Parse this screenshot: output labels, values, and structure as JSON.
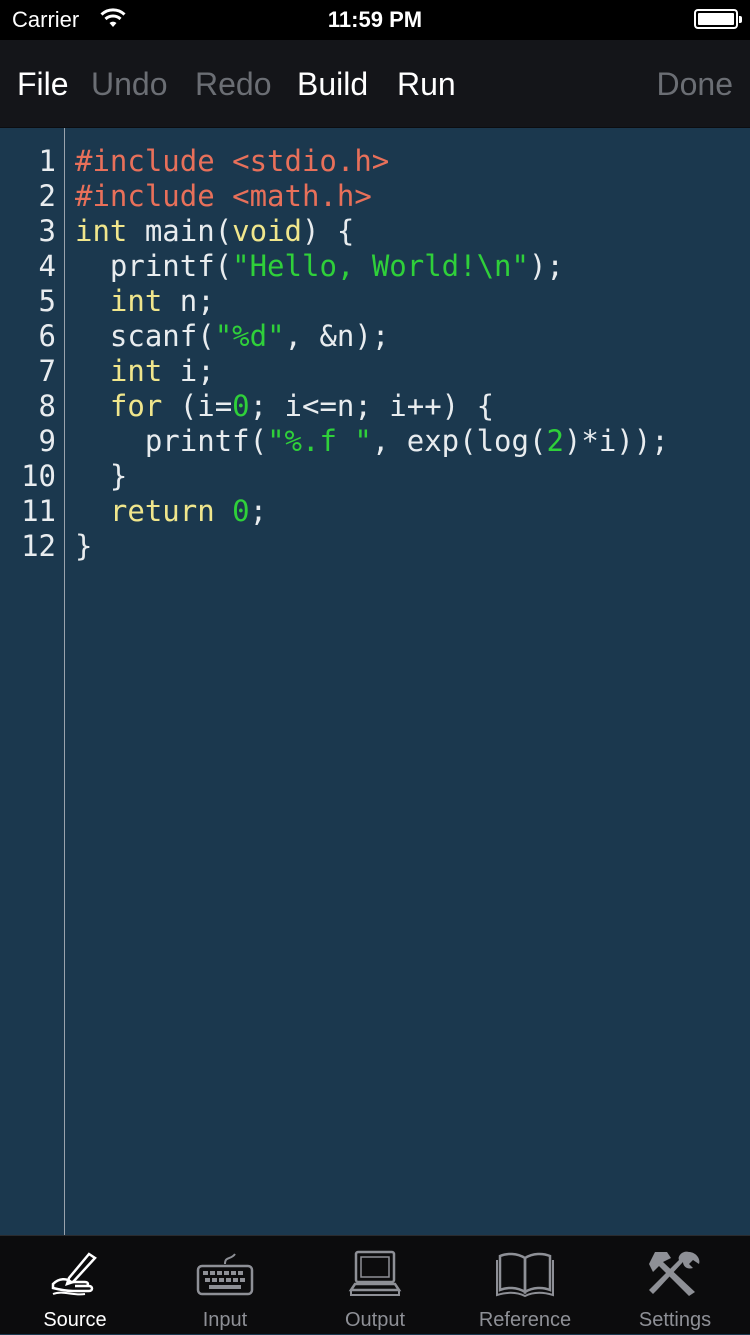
{
  "status_bar": {
    "carrier": "Carrier",
    "time": "11:59 PM",
    "battery_level": 1.0
  },
  "toolbar": {
    "file": "File",
    "undo": "Undo",
    "redo": "Redo",
    "build": "Build",
    "run": "Run",
    "done": "Done"
  },
  "colors": {
    "editor_background": "#1b384e",
    "directive": "#e8705a",
    "keyword": "#f0e68c",
    "string": "#2fd03a",
    "number": "#2fd03a",
    "plain": "#e8ecef"
  },
  "code": {
    "lines": [
      {
        "number": "1",
        "tokens": [
          {
            "t": "directive",
            "v": "#include <stdio.h>"
          }
        ]
      },
      {
        "number": "2",
        "tokens": [
          {
            "t": "directive",
            "v": "#include <math.h>"
          }
        ]
      },
      {
        "number": "3",
        "tokens": [
          {
            "t": "keyword",
            "v": "int"
          },
          {
            "t": "plain",
            "v": " main("
          },
          {
            "t": "keyword",
            "v": "void"
          },
          {
            "t": "plain",
            "v": ") {"
          }
        ]
      },
      {
        "number": "4",
        "tokens": [
          {
            "t": "plain",
            "v": "  printf("
          },
          {
            "t": "string",
            "v": "\"Hello, World!\\n\""
          },
          {
            "t": "plain",
            "v": ");"
          }
        ]
      },
      {
        "number": "5",
        "tokens": [
          {
            "t": "plain",
            "v": "  "
          },
          {
            "t": "keyword",
            "v": "int"
          },
          {
            "t": "plain",
            "v": " n;"
          }
        ]
      },
      {
        "number": "6",
        "tokens": [
          {
            "t": "plain",
            "v": "  scanf("
          },
          {
            "t": "string",
            "v": "\"%d\""
          },
          {
            "t": "plain",
            "v": ", &n);"
          }
        ]
      },
      {
        "number": "7",
        "tokens": [
          {
            "t": "plain",
            "v": "  "
          },
          {
            "t": "keyword",
            "v": "int"
          },
          {
            "t": "plain",
            "v": " i;"
          }
        ]
      },
      {
        "number": "8",
        "tokens": [
          {
            "t": "plain",
            "v": "  "
          },
          {
            "t": "keyword",
            "v": "for"
          },
          {
            "t": "plain",
            "v": " (i="
          },
          {
            "t": "number",
            "v": "0"
          },
          {
            "t": "plain",
            "v": "; i<=n; i++) {"
          }
        ]
      },
      {
        "number": "9",
        "tokens": [
          {
            "t": "plain",
            "v": "    printf("
          },
          {
            "t": "string",
            "v": "\"%.f \""
          },
          {
            "t": "plain",
            "v": ", exp(log("
          },
          {
            "t": "number",
            "v": "2"
          },
          {
            "t": "plain",
            "v": ")*i));"
          }
        ]
      },
      {
        "number": "10",
        "tokens": [
          {
            "t": "plain",
            "v": "  }"
          }
        ]
      },
      {
        "number": "11",
        "tokens": [
          {
            "t": "plain",
            "v": "  "
          },
          {
            "t": "keyword",
            "v": "return"
          },
          {
            "t": "plain",
            "v": " "
          },
          {
            "t": "number",
            "v": "0"
          },
          {
            "t": "plain",
            "v": ";"
          }
        ]
      },
      {
        "number": "12",
        "tokens": [
          {
            "t": "plain",
            "v": "}"
          }
        ]
      }
    ]
  },
  "tab_bar": {
    "tabs": [
      {
        "label": "Source",
        "icon": "pen-hand-icon",
        "active": true
      },
      {
        "label": "Input",
        "icon": "keyboard-icon",
        "active": false
      },
      {
        "label": "Output",
        "icon": "computer-icon",
        "active": false
      },
      {
        "label": "Reference",
        "icon": "book-icon",
        "active": false
      },
      {
        "label": "Settings",
        "icon": "tools-icon",
        "active": false
      }
    ]
  }
}
